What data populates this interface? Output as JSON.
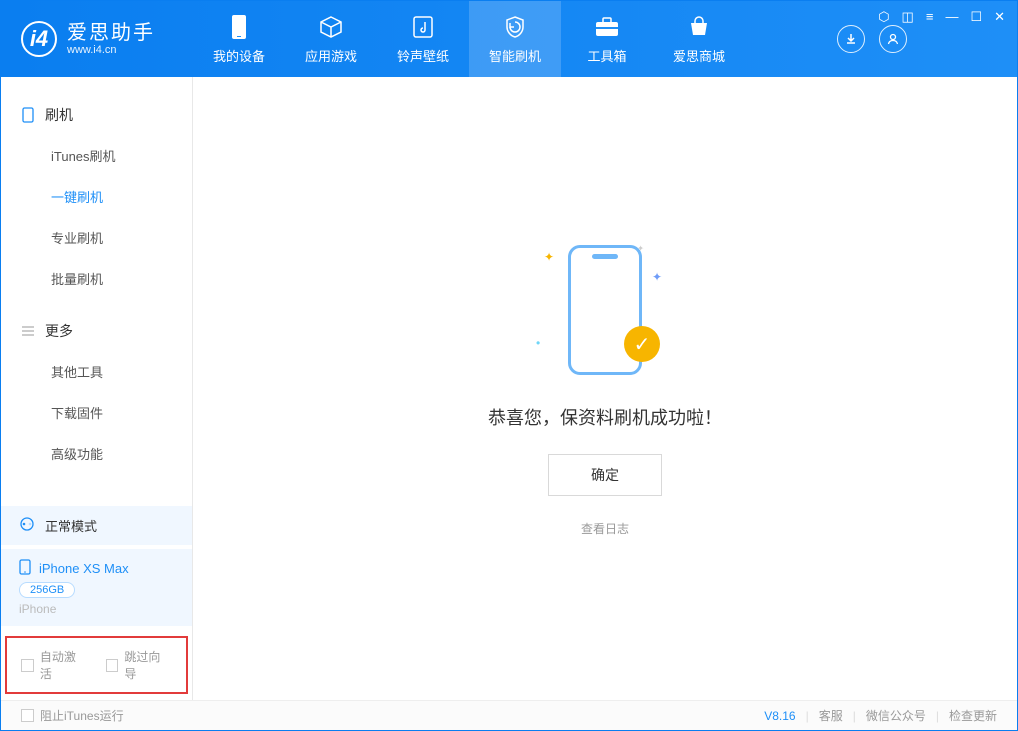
{
  "app": {
    "title": "爱思助手",
    "subtitle": "www.i4.cn",
    "version": "V8.16"
  },
  "nav": {
    "tabs": [
      {
        "label": "我的设备",
        "icon": "device-icon"
      },
      {
        "label": "应用游戏",
        "icon": "cube-icon"
      },
      {
        "label": "铃声壁纸",
        "icon": "music-icon"
      },
      {
        "label": "智能刷机",
        "icon": "shield-icon",
        "active": true
      },
      {
        "label": "工具箱",
        "icon": "toolbox-icon"
      },
      {
        "label": "爱思商城",
        "icon": "shop-icon"
      }
    ]
  },
  "sidebar": {
    "groups": [
      {
        "title": "刷机",
        "icon": "phone-icon",
        "items": [
          {
            "label": "iTunes刷机"
          },
          {
            "label": "一键刷机",
            "active": true
          },
          {
            "label": "专业刷机"
          },
          {
            "label": "批量刷机"
          }
        ]
      },
      {
        "title": "更多",
        "icon": "list-icon",
        "items": [
          {
            "label": "其他工具"
          },
          {
            "label": "下载固件"
          },
          {
            "label": "高级功能"
          }
        ]
      }
    ],
    "mode": {
      "label": "正常模式"
    },
    "device": {
      "name": "iPhone XS Max",
      "capacity": "256GB",
      "type": "iPhone"
    },
    "options": {
      "auto_activate": "自动激活",
      "skip_guide": "跳过向导"
    }
  },
  "main": {
    "success": "恭喜您，保资料刷机成功啦！",
    "ok": "确定",
    "view_log": "查看日志"
  },
  "statusbar": {
    "block_itunes": "阻止iTunes运行",
    "links": [
      "客服",
      "微信公众号",
      "检查更新"
    ]
  }
}
